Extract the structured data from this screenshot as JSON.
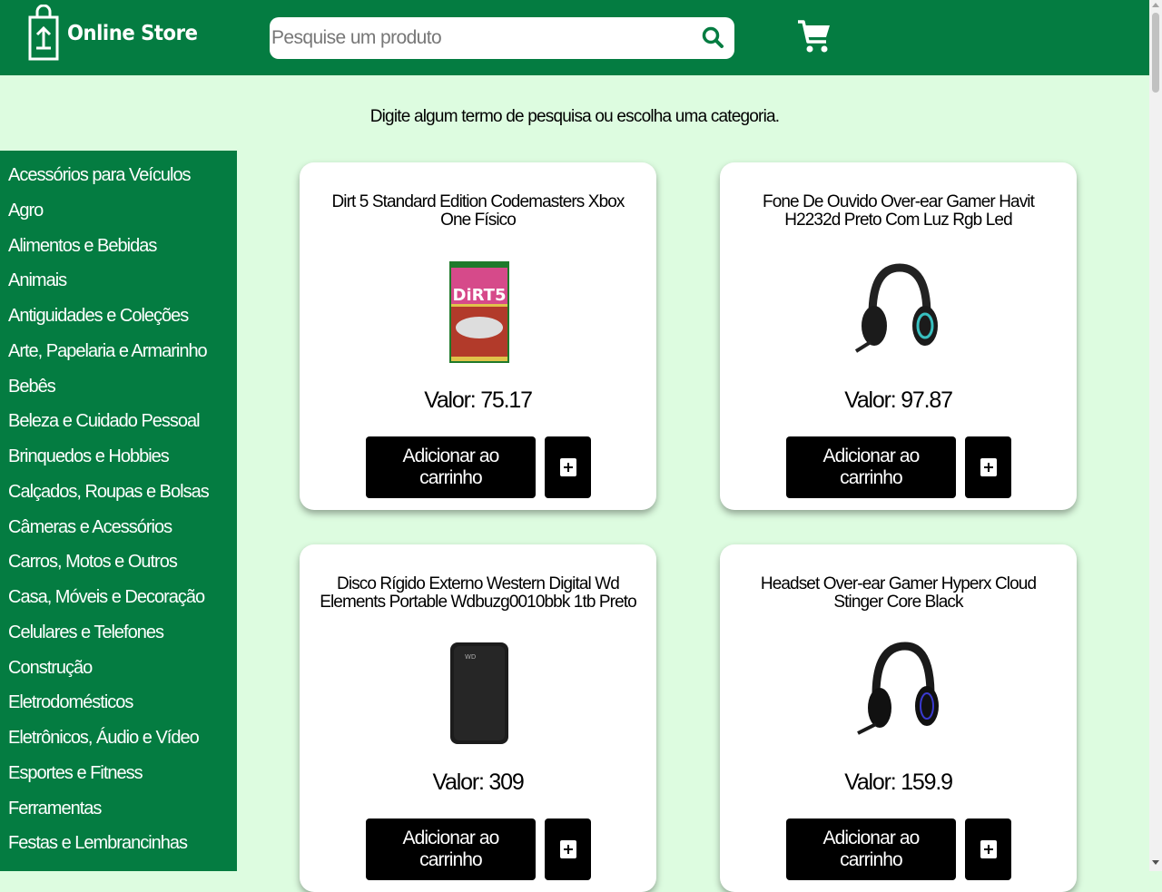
{
  "header": {
    "logo_text": "Online Store",
    "search_placeholder": "Pesquise um produto",
    "search_icon": "search-icon",
    "cart_icon": "cart-icon",
    "colors": {
      "bar": "#047c41",
      "page_bg": "#ddfce0"
    }
  },
  "hint": "Digite algum termo de pesquisa ou escolha uma categoria.",
  "categories": [
    "Acessórios para Veículos",
    "Agro",
    "Alimentos e Bebidas",
    "Animais",
    "Antiguidades e Coleções",
    "Arte, Papelaria e Armarinho",
    "Bebês",
    "Beleza e Cuidado Pessoal",
    "Brinquedos e Hobbies",
    "Calçados, Roupas e Bolsas",
    "Câmeras e Acessórios",
    "Carros, Motos e Outros",
    "Casa, Móveis e Decoração",
    "Celulares e Telefones",
    "Construção",
    "Eletrodomésticos",
    "Eletrônicos, Áudio e Vídeo",
    "Esportes e Fitness",
    "Ferramentas",
    "Festas e Lembrancinhas"
  ],
  "products": [
    {
      "title": "Dirt 5 Standard Edition Codemasters Xbox One Físico",
      "image": "game-case-image",
      "price": "Valor: 75.17",
      "add_label": "Adicionar ao carrinho",
      "plus_icon": "plus-icon"
    },
    {
      "title": "Fone De Ouvido Over-ear Gamer Havit H2232d Preto Com Luz Rgb Led",
      "image": "headset-rgb-image",
      "price": "Valor: 97.87",
      "add_label": "Adicionar ao carrinho",
      "plus_icon": "plus-icon"
    },
    {
      "title": "Disco Rígido Externo Western Digital Wd Elements Portable Wdbuzg0010bbk 1tb Preto",
      "image": "hard-drive-image",
      "price": "Valor: 309",
      "add_label": "Adicionar ao carrinho",
      "plus_icon": "plus-icon"
    },
    {
      "title": "Headset Over-ear Gamer Hyperx Cloud Stinger Core Black",
      "image": "headset-black-image",
      "price": "Valor: 159.9",
      "add_label": "Adicionar ao carrinho",
      "plus_icon": "plus-icon"
    }
  ]
}
